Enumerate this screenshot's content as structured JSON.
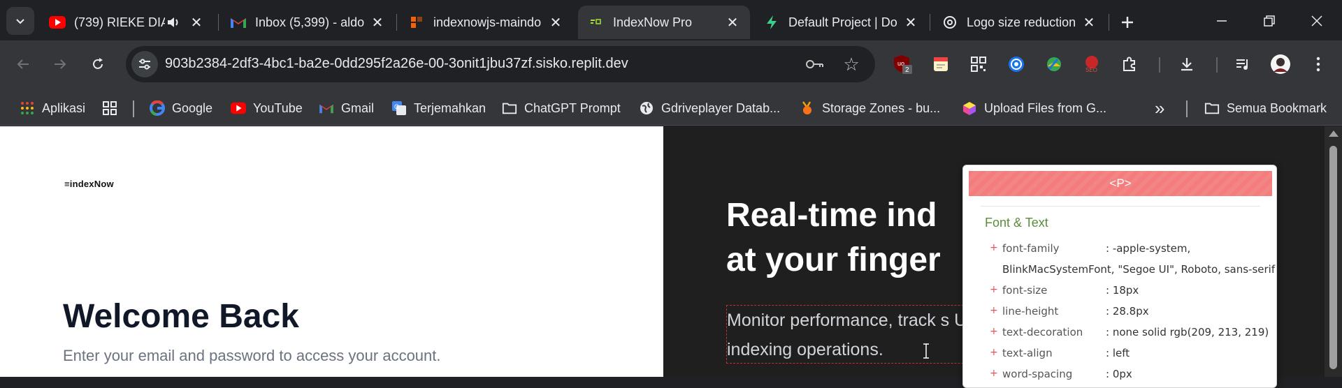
{
  "tabs": [
    {
      "title": "(739) RIEKE DIA",
      "favicon": "youtube-icon",
      "audio": true
    },
    {
      "title": "Inbox (5,399) - aldo",
      "favicon": "gmail-icon"
    },
    {
      "title": "indexnowjs-maindo",
      "favicon": "figma-like-icon"
    },
    {
      "title": "IndexNow Pro",
      "favicon": "indexnow-icon",
      "active": true
    },
    {
      "title": "Default Project | Do",
      "favicon": "supabase-icon"
    },
    {
      "title": "Logo size reduction",
      "favicon": "openai-icon"
    }
  ],
  "toolbar": {
    "url": "903b2384-2df3-4bc1-ba2e-0dd295f2a26e-00-3onit1jbu37zf.sisko.replit.dev",
    "extension_badge": "2"
  },
  "bookmarks": {
    "items": [
      {
        "label": "Aplikasi",
        "icon": "apps-grid-icon"
      },
      {
        "label": "Google",
        "icon": "google-icon"
      },
      {
        "label": "YouTube",
        "icon": "youtube-icon"
      },
      {
        "label": "Gmail",
        "icon": "gmail-icon"
      },
      {
        "label": "Terjemahkan",
        "icon": "translate-icon"
      },
      {
        "label": "ChatGPT Prompt",
        "icon": "folder-icon"
      },
      {
        "label": "Gdriveplayer Datab...",
        "icon": "globe-icon"
      },
      {
        "label": "Storage Zones - bu...",
        "icon": "bunny-icon"
      },
      {
        "label": "Upload Files from G...",
        "icon": "cube-icon"
      }
    ],
    "more": "»",
    "all_bookmarks": "Semua Bookmark"
  },
  "page": {
    "logo": "≡indexNow",
    "welcome": "Welcome Back",
    "subtitle": "Enter your email and password to access your account.",
    "hero_title_line1": "Real-time ind",
    "hero_title_line2": "at your finger",
    "hero_desc": "Monitor performance, track s URL indexing operations."
  },
  "inspector": {
    "tag": "<P>",
    "section": "Font & Text",
    "props": [
      {
        "name": "font-family",
        "value": ": -apple-system,",
        "cont": "BlinkMacSystemFont, \"Segoe UI\", Roboto, sans-serif"
      },
      {
        "name": "font-size",
        "value": ": 18px"
      },
      {
        "name": "line-height",
        "value": ": 28.8px"
      },
      {
        "name": "text-decoration",
        "value": ": none solid rgb(209, 213, 219)"
      },
      {
        "name": "text-align",
        "value": ": left"
      },
      {
        "name": "word-spacing",
        "value": ": 0px"
      }
    ]
  }
}
